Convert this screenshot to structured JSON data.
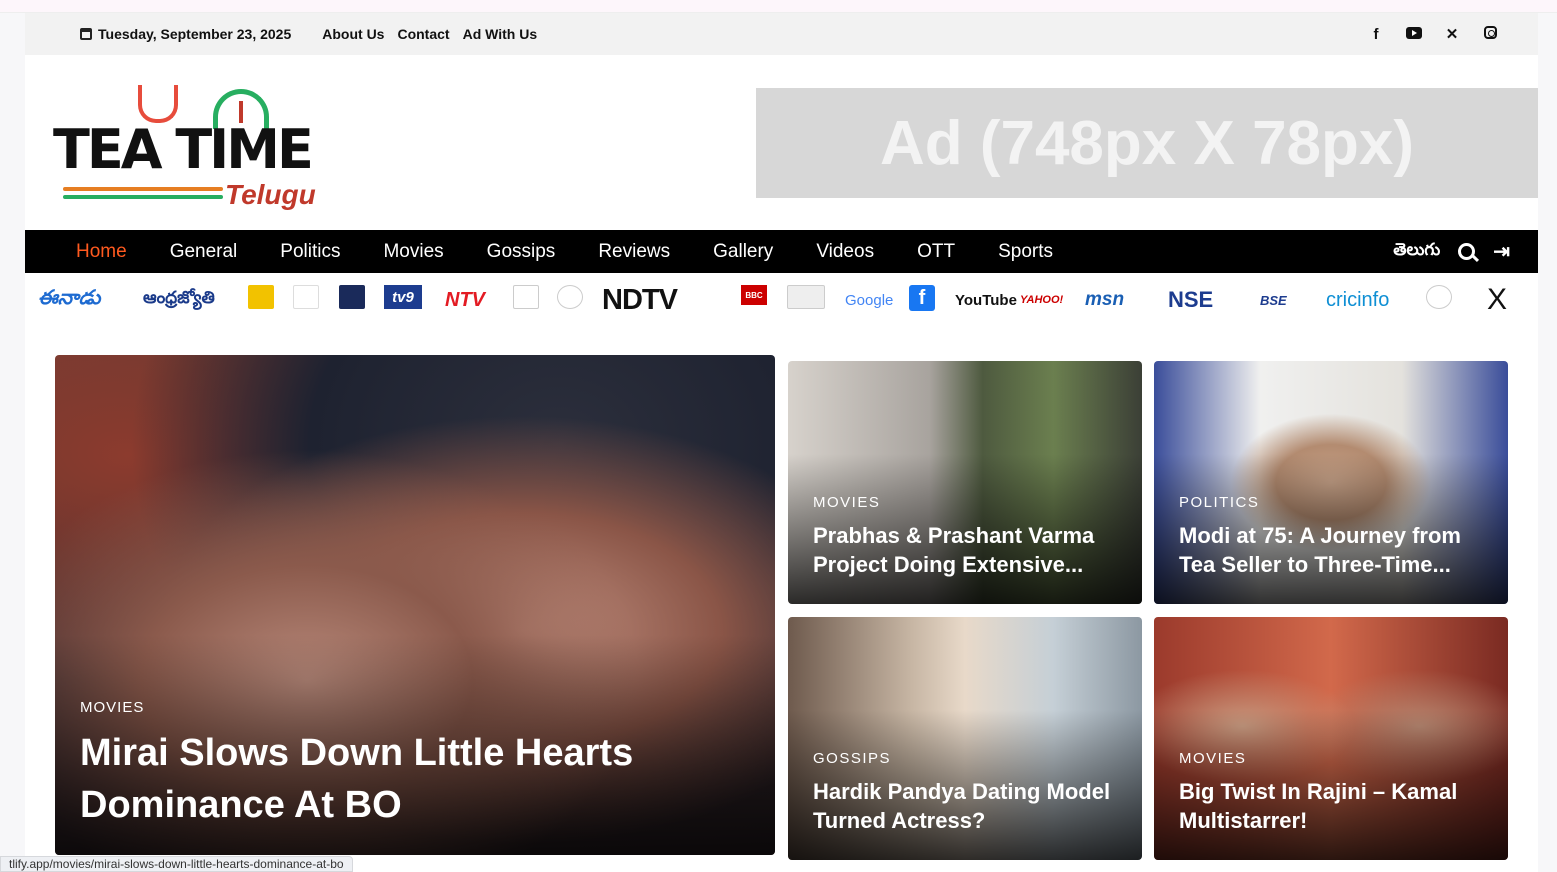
{
  "topbar": {
    "date": "Tuesday, September 23, 2025",
    "links": [
      "About Us",
      "Contact",
      "Ad With Us"
    ],
    "socials": [
      "facebook-icon",
      "youtube-icon",
      "x-icon",
      "instagram-icon"
    ]
  },
  "logo": {
    "line1": "TEA TIME",
    "line2": "Telugu"
  },
  "ad": {
    "label": "Ad (748px X 78px)"
  },
  "nav": {
    "items": [
      "Home",
      "General",
      "Politics",
      "Movies",
      "Gossips",
      "Reviews",
      "Gallery",
      "Videos",
      "OTT",
      "Sports"
    ],
    "active": "Home",
    "language": "తెలుగు",
    "accent_color": "#ff5a1f"
  },
  "sources": {
    "eenadu": "ఈనాడు",
    "andhra": "ఆంధ్రజ్యోతి",
    "tv9": "tv9",
    "ntv": "NTV",
    "ndtv": "NDTV",
    "bbc": "BBC",
    "google": "Google",
    "facebook": "f",
    "youtube": "YouTube",
    "yahoo": "YAHOO!",
    "msn": "msn",
    "nse": "NSE",
    "bse": "BSE",
    "cricinfo": "cricinfo",
    "x": "X"
  },
  "hero": {
    "category": "MOVIES",
    "title": "Mirai Slows Down Little Hearts Dominance At BO"
  },
  "cards": [
    {
      "category": "MOVIES",
      "title": "Prabhas & Prashant Varma Project Doing Extensive..."
    },
    {
      "category": "POLITICS",
      "title": "Modi at 75: A Journey from Tea Seller to Three-Time..."
    },
    {
      "category": "GOSSIPS",
      "title": "Hardik Pandya Dating Model Turned Actress?"
    },
    {
      "category": "MOVIES",
      "title": "Big Twist In Rajini – Kamal Multistarrer!"
    }
  ],
  "statusbar": {
    "url": "tlify.app/movies/mirai-slows-down-little-hearts-dominance-at-bo"
  }
}
